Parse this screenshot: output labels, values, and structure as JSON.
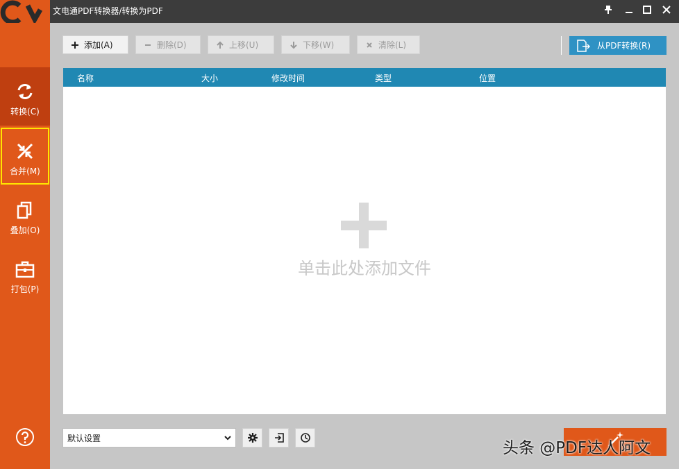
{
  "window": {
    "title": "文电通PDF转换器/转换为PDF",
    "controls": {
      "pin_icon": "pin-icon",
      "minimize_icon": "minimize-icon",
      "maximize_icon": "maximize-icon",
      "close_icon": "close-icon"
    }
  },
  "sidebar": {
    "items": [
      {
        "label": "转换(C)",
        "icon": "convert-icon",
        "state": "active"
      },
      {
        "label": "合并(M)",
        "icon": "merge-icon",
        "state": "highlighted"
      },
      {
        "label": "叠加(O)",
        "icon": "overlay-icon",
        "state": "normal"
      },
      {
        "label": "打包(P)",
        "icon": "package-icon",
        "state": "normal"
      }
    ],
    "help_icon": "help-icon"
  },
  "toolbar": {
    "add": "添加(A)",
    "delete": "删除(D)",
    "move_up": "上移(U)",
    "move_down": "下移(W)",
    "clear": "清除(L)",
    "convert_from_pdf": "从PDF转换(R)"
  },
  "table": {
    "columns": [
      "名称",
      "大小",
      "修改时间",
      "类型",
      "位置"
    ],
    "rows": [],
    "empty_hint": "单击此处添加文件"
  },
  "bottom": {
    "preset_value": "默认设置",
    "settings_icon": "gear-icon",
    "output_icon": "export-icon",
    "schedule_icon": "clock-icon"
  },
  "watermark": "头条 @PDF达人阿文",
  "colors": {
    "sidebar": "#e0581a",
    "sidebar_active": "#bf3f10",
    "highlight_border": "#ffe600",
    "table_header": "#2088b3",
    "convert_button": "#2f92c4",
    "titlebar": "#3c3c3c"
  }
}
